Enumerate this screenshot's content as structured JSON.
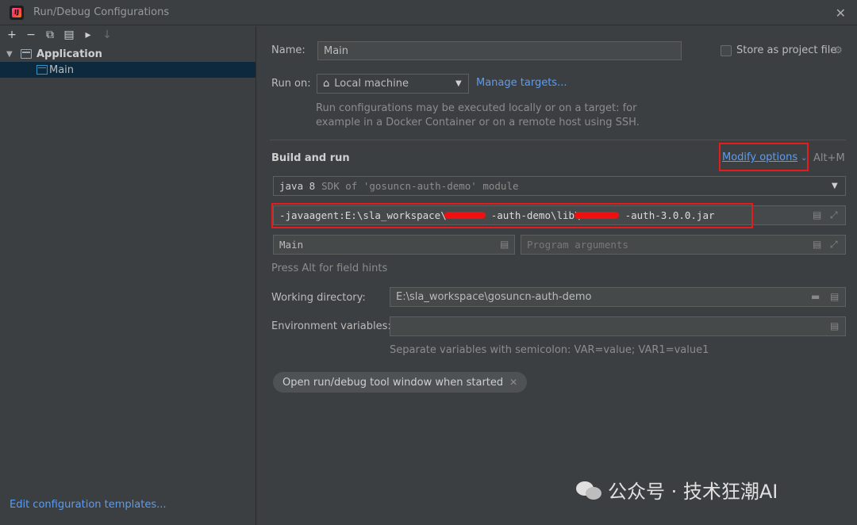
{
  "window": {
    "title": "Run/Debug Configurations",
    "close_icon": "close-icon"
  },
  "toolbar": {
    "icons": [
      "add-icon",
      "remove-icon",
      "copy-icon",
      "save-icon",
      "move-to-folder-icon",
      "sort-icon"
    ],
    "glyphs": [
      "+",
      "−",
      "⧉",
      "▤",
      "▸",
      "↓"
    ]
  },
  "tree": {
    "group_label": "Application",
    "child_label": "Main"
  },
  "left_footer": {
    "edit_templates": "Edit configuration templates..."
  },
  "form": {
    "name_label": "Name:",
    "name_value": "Main",
    "store_label": "Store as project file",
    "store_checked": false,
    "run_on_label": "Run on:",
    "run_on_value": "Local machine",
    "manage_targets": "Manage targets...",
    "run_on_hint_line1": "Run configurations may be executed locally or on a target: for",
    "run_on_hint_line2": "example in a Docker Container or on a remote host using SSH.",
    "build_and_run_title": "Build and run",
    "modify_options": "Modify options",
    "modify_shortcut": "Alt+M",
    "sdk_value": "java 8",
    "sdk_hint": "SDK of 'gosuncn-auth-demo' module",
    "vm_options_part1": "-javaagent:E:\\sla_workspace\\",
    "vm_options_part2": "-auth-demo\\lib\\",
    "vm_options_part3": "-auth-3.0.0.jar",
    "main_class_value": "Main",
    "program_args_placeholder": "Program arguments",
    "field_hints": "Press Alt for field hints",
    "working_dir_label": "Working directory:",
    "working_dir_value": "E:\\sla_workspace\\gosuncn-auth-demo",
    "env_vars_label": "Environment variables:",
    "env_vars_value": "",
    "env_vars_hint": "Separate variables with semicolon: VAR=value; VAR1=value1",
    "chip_label": "Open run/debug tool window when started"
  },
  "watermark": {
    "text": "公众号 · 技术狂潮AI"
  },
  "colors": {
    "accent_link": "#589df6",
    "highlight_box": "#e41c1c",
    "selection": "#0d293e"
  }
}
